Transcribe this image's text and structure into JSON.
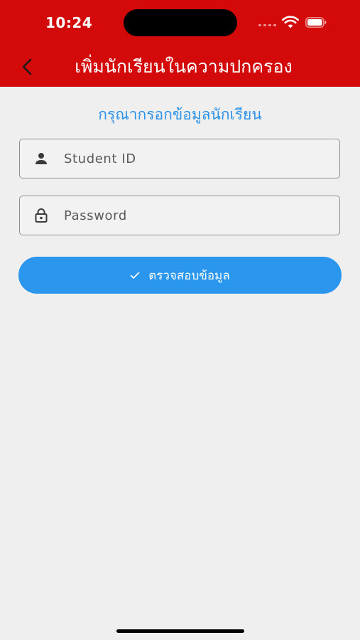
{
  "status_bar": {
    "time": "10:24"
  },
  "nav": {
    "title": "เพิ่มนักเรียนในความปกครอง",
    "back_icon": "chevron-left-icon"
  },
  "form": {
    "subtitle": "กรุณากรอกข้อมูลนักเรียน",
    "student_id": {
      "placeholder": "Student ID",
      "value": "",
      "icon": "person-icon"
    },
    "password": {
      "placeholder": "Password",
      "value": "",
      "icon": "lock-icon"
    },
    "verify_button": {
      "label": "ตรวจสอบข้อมูล",
      "icon": "check-icon"
    }
  },
  "colors": {
    "header": "#d40a0a",
    "accent": "#2a96ee",
    "background": "#efefef"
  }
}
